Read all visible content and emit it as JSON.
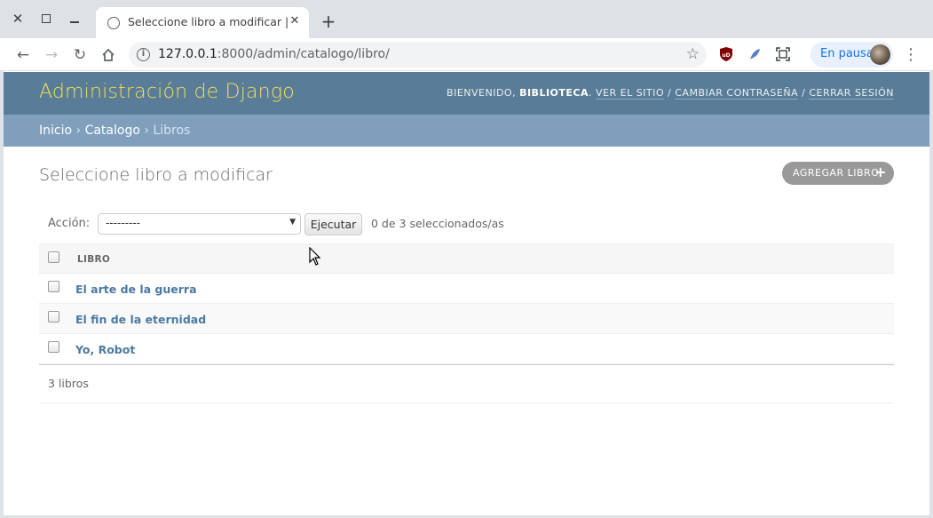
{
  "browser": {
    "tab_title": "Seleccione libro a modificar | ",
    "tab_title_fade": "S",
    "url_host": "127.0.0.1",
    "url_rest": ":8000/admin/catalogo/libro/",
    "profile_label": "En pausa"
  },
  "header": {
    "site_title": "Administración de Django",
    "welcome": "Bienvenido,",
    "user": "Biblioteca",
    "links": [
      "Ver el sitio",
      "Cambiar contraseña",
      "Cerrar sesión"
    ]
  },
  "breadcrumbs": {
    "home": "Inicio",
    "app": "Catalogo",
    "current": "Libros",
    "separator": "›"
  },
  "content": {
    "title": "Seleccione libro a modificar",
    "add_button": "Agregar libro"
  },
  "actions": {
    "label": "Acción:",
    "selected": "---------",
    "go_button": "Ejecutar",
    "counter": "0 de 3 seleccionados/as"
  },
  "table": {
    "header": "Libro",
    "rows": [
      "El arte de la guerra",
      "El fin de la eternidad",
      "Yo, Robot"
    ]
  },
  "paginator": "3 libros",
  "colors": {
    "header_bg": "#597d98",
    "breadcrumbs_bg": "#7f9fbd",
    "title_yellow": "#f5dd5d",
    "link_blue": "#4c79a0"
  }
}
